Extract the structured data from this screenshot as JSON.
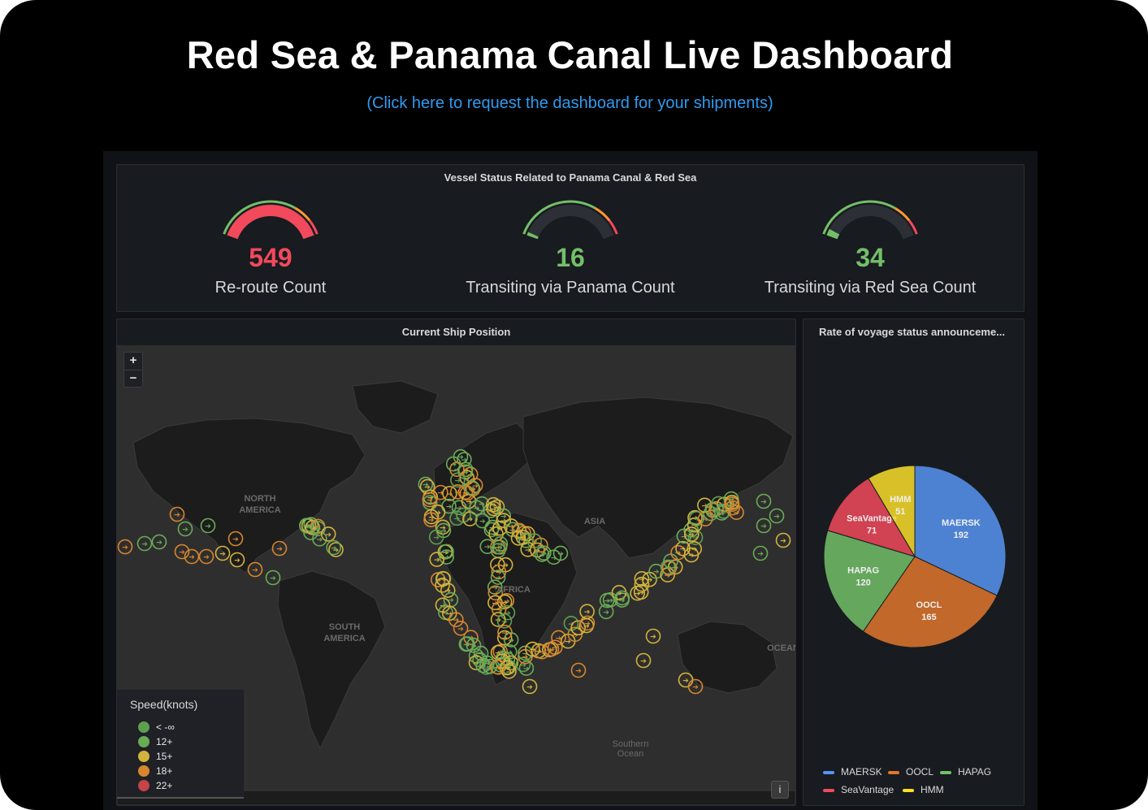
{
  "page": {
    "title": "Red Sea & Panama Canal Live Dashboard",
    "link_text": "(Click here to request the dashboard for your shipments)"
  },
  "status_panel": {
    "title": "Vessel Status Related to Panama Canal & Red Sea",
    "gauges": [
      {
        "value": "549",
        "label": "Re-route Count",
        "color": "#f2495c",
        "fill_fraction": 1.0
      },
      {
        "value": "16",
        "label": "Transiting via Panama Count",
        "color": "#73bf69",
        "fill_fraction": 0.03
      },
      {
        "value": "34",
        "label": "Transiting via Red Sea Count",
        "color": "#73bf69",
        "fill_fraction": 0.06
      }
    ]
  },
  "map_panel": {
    "title": "Current Ship Position",
    "zoom_in": "+",
    "zoom_out": "−",
    "info": "i",
    "place_labels": [
      "NORTH",
      "AMERICA",
      "ASIA",
      "AFRICA",
      "SOUTH",
      "AMERICA",
      "OCEAN",
      "Southern",
      "Ocean"
    ],
    "legend": {
      "title": "Speed(knots)",
      "items": [
        {
          "label": "< -∞",
          "color": "#5e9e50"
        },
        {
          "label": "12+",
          "color": "#6aab58"
        },
        {
          "label": "15+",
          "color": "#d3b33c"
        },
        {
          "label": "18+",
          "color": "#d8862e"
        },
        {
          "label": "22+",
          "color": "#c44449"
        }
      ]
    }
  },
  "pie_panel": {
    "title": "Rate of voyage status announceme...",
    "chart_data": {
      "type": "pie",
      "title": "Rate of voyage status announceme...",
      "slices": [
        {
          "name": "MAERSK",
          "value": 192,
          "color": "#5794f2"
        },
        {
          "name": "OOCL",
          "value": 165,
          "color": "#e0752d"
        },
        {
          "name": "HAPAG",
          "value": 120,
          "color": "#73bf69"
        },
        {
          "name": "SeaVantage",
          "value": 71,
          "color": "#f2495c"
        },
        {
          "name": "HMM",
          "value": 51,
          "color": "#fade2a"
        }
      ],
      "legend_position": "bottom"
    }
  }
}
